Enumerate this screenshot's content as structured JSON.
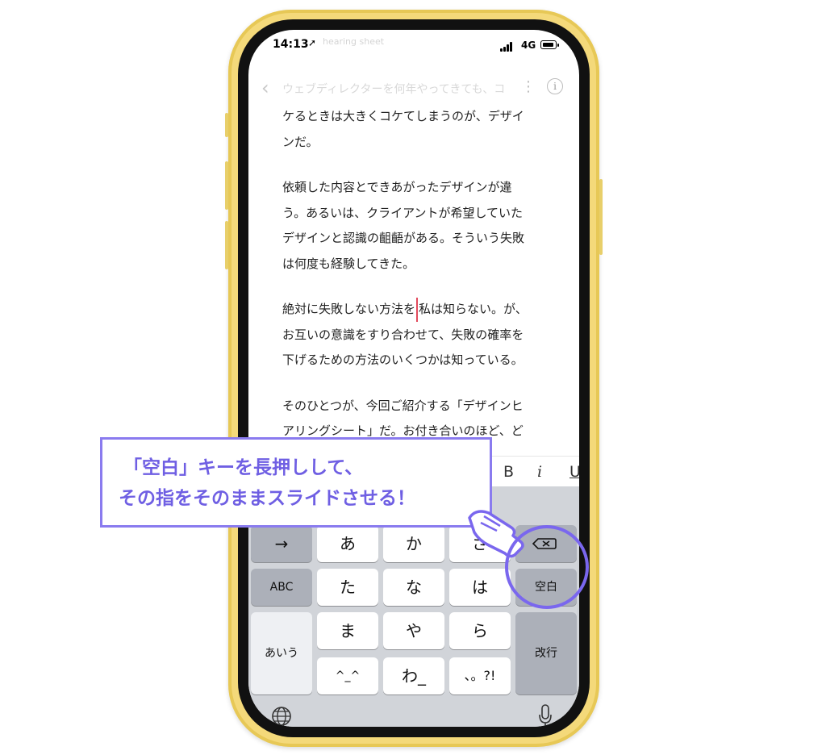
{
  "status_bar": {
    "time": "14:13",
    "ghost_text": "hearing sheet",
    "network": "4G"
  },
  "nav": {
    "title": "ウェブディレクターを何年やってきても、コ",
    "more_icon": "more-vertical-icon",
    "info_icon": "info-icon"
  },
  "article": {
    "paragraphs": [
      {
        "lines": [
          "ケるときは大きくコケてしまうのが、デザイ",
          "ンだ。"
        ]
      },
      {
        "lines": [
          "依頼した内容とできあがったデザインが違",
          "う。あるいは、クライアントが希望していた",
          "デザインと認識の齟齬がある。そういう失敗",
          "は何度も経験してきた。"
        ]
      },
      {
        "line1_before_cursor": "絶対に失敗しない方法を",
        "line1_after_cursor": "私は知らない。が、",
        "lines": [
          "お互いの意識をすり合わせて、失敗の確率を",
          "下げるための方法のいくつかは知っている。"
        ]
      },
      {
        "lines": [
          "そのひとつが、今回ご紹介する「デザインヒ",
          "アリングシート」だ。お付き合いのほど、ど"
        ]
      }
    ]
  },
  "format_bar": {
    "bold": "B",
    "italic": "i",
    "underline": "U"
  },
  "keyboard": {
    "keys": {
      "arrow": "→",
      "a": "あ",
      "ka": "か",
      "sa": "さ",
      "abc": "ABC",
      "ta": "た",
      "na": "な",
      "ha": "は",
      "space": "空白",
      "aiu": "あいう",
      "ma": "ま",
      "ya": "や",
      "ra": "ら",
      "enter": "改行",
      "kaomoji": "^_^",
      "wa": "わ_",
      "punct": "、。?!"
    }
  },
  "callout": {
    "line1": "「空白」キーを長押しして、",
    "line2": "その指をそのままスライドさせる！"
  },
  "colors": {
    "accent": "#7a67ee",
    "phone_frame": "#f4d97a",
    "cursor": "#e24a5c"
  }
}
